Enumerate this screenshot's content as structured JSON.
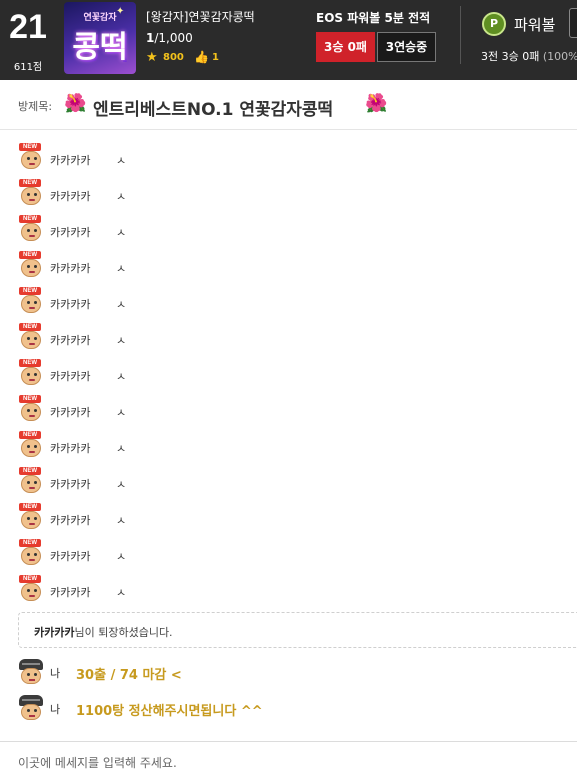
{
  "header": {
    "rank": "21",
    "points": "611점",
    "thumbnail": {
      "top_text": "연꽃감자",
      "main_text": "콩떡"
    },
    "room_name": "[왕감자]연꽃감자콩떡",
    "participants_current": "1",
    "participants_max": "/1,000",
    "stars": "800",
    "likes": "1",
    "stat_title": "EOS 파워볼 5분 전적",
    "win_badge": "3승 0패",
    "streak_badge": "3연승중",
    "powerball_icon": "P",
    "powerball_label": "파워볼",
    "powerball_record": "3전 3승 0패",
    "powerball_rate": "(100%"
  },
  "title_bar": {
    "label": "방제목:",
    "flower_icon": "🌺",
    "title": "엔트리베스트NO.1 연꽃감자콩떡"
  },
  "chat": {
    "messages": [
      {
        "nick": "카카카카",
        "text": "ㅅ"
      },
      {
        "nick": "카카카카",
        "text": "ㅅ"
      },
      {
        "nick": "카카카카",
        "text": "ㅅ"
      },
      {
        "nick": "카카카카",
        "text": "ㅅ"
      },
      {
        "nick": "카카카카",
        "text": "ㅅ"
      },
      {
        "nick": "카카카카",
        "text": "ㅅ"
      },
      {
        "nick": "카카카카",
        "text": "ㅅ"
      },
      {
        "nick": "카카카카",
        "text": "ㅅ"
      },
      {
        "nick": "카카카카",
        "text": "ㅅ"
      },
      {
        "nick": "카카카카",
        "text": "ㅅ"
      },
      {
        "nick": "카카카카",
        "text": "ㅅ"
      },
      {
        "nick": "카카카카",
        "text": "ㅅ"
      },
      {
        "nick": "카카카카",
        "text": "ㅅ"
      }
    ],
    "new_badge": "NEW",
    "exit_notice": {
      "nick": "카카카카",
      "suffix": "님이 퇴장하셨습니다."
    },
    "my_messages": [
      {
        "nick": "나",
        "text": "30출 / 74 마감 <"
      },
      {
        "nick": "나",
        "text": "1100탕 정산해주시면됩니다 ^^"
      }
    ]
  },
  "input": {
    "placeholder": "이곳에 메세지를 입력해 주세요."
  },
  "colors": {
    "header_bg": "#2b2b2b",
    "win_red": "#d0222a",
    "gold_text": "#c79a1e",
    "powerball_green": "#5f8f22"
  }
}
